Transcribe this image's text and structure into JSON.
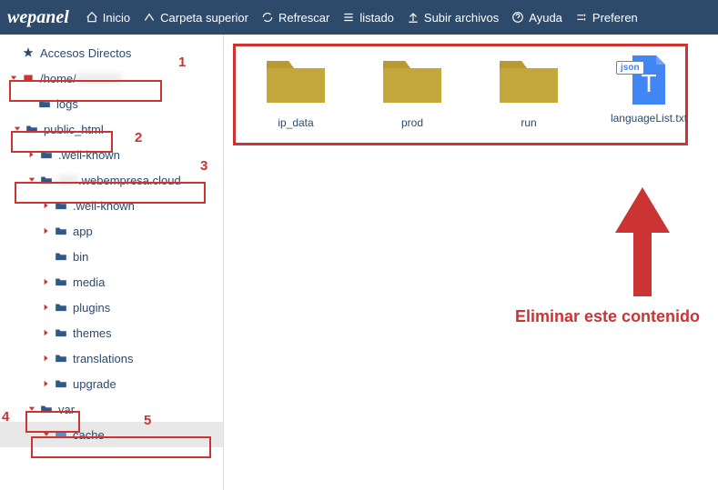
{
  "logo": "wepanel",
  "header": {
    "inicio": "Inicio",
    "carpeta": "Carpeta superior",
    "refrescar": "Refrescar",
    "listado": "listado",
    "subir": "Subir archivos",
    "ayuda": "Ayuda",
    "prefer": "Preferen"
  },
  "tree": {
    "accesos": "Accesos Directos",
    "home": "/home/",
    "logs": "logs",
    "public_html": "public_html",
    "well_known1": ".well-known",
    "webempresa": ".webempresa.cloud",
    "well_known2": ".well-known",
    "app": "app",
    "bin": "bin",
    "media": "media",
    "plugins": "plugins",
    "themes": "themes",
    "translations": "translations",
    "upgrade": "upgrade",
    "var": "var",
    "cache": "cache"
  },
  "annotations": {
    "n1": "1",
    "n2": "2",
    "n3": "3",
    "n4": "4",
    "n5": "5",
    "delete": "Eliminar este contenido"
  },
  "files": {
    "ip_data": "ip_data",
    "prod": "prod",
    "run": "run",
    "languageList": "languageList.txt",
    "json_badge": "json"
  }
}
